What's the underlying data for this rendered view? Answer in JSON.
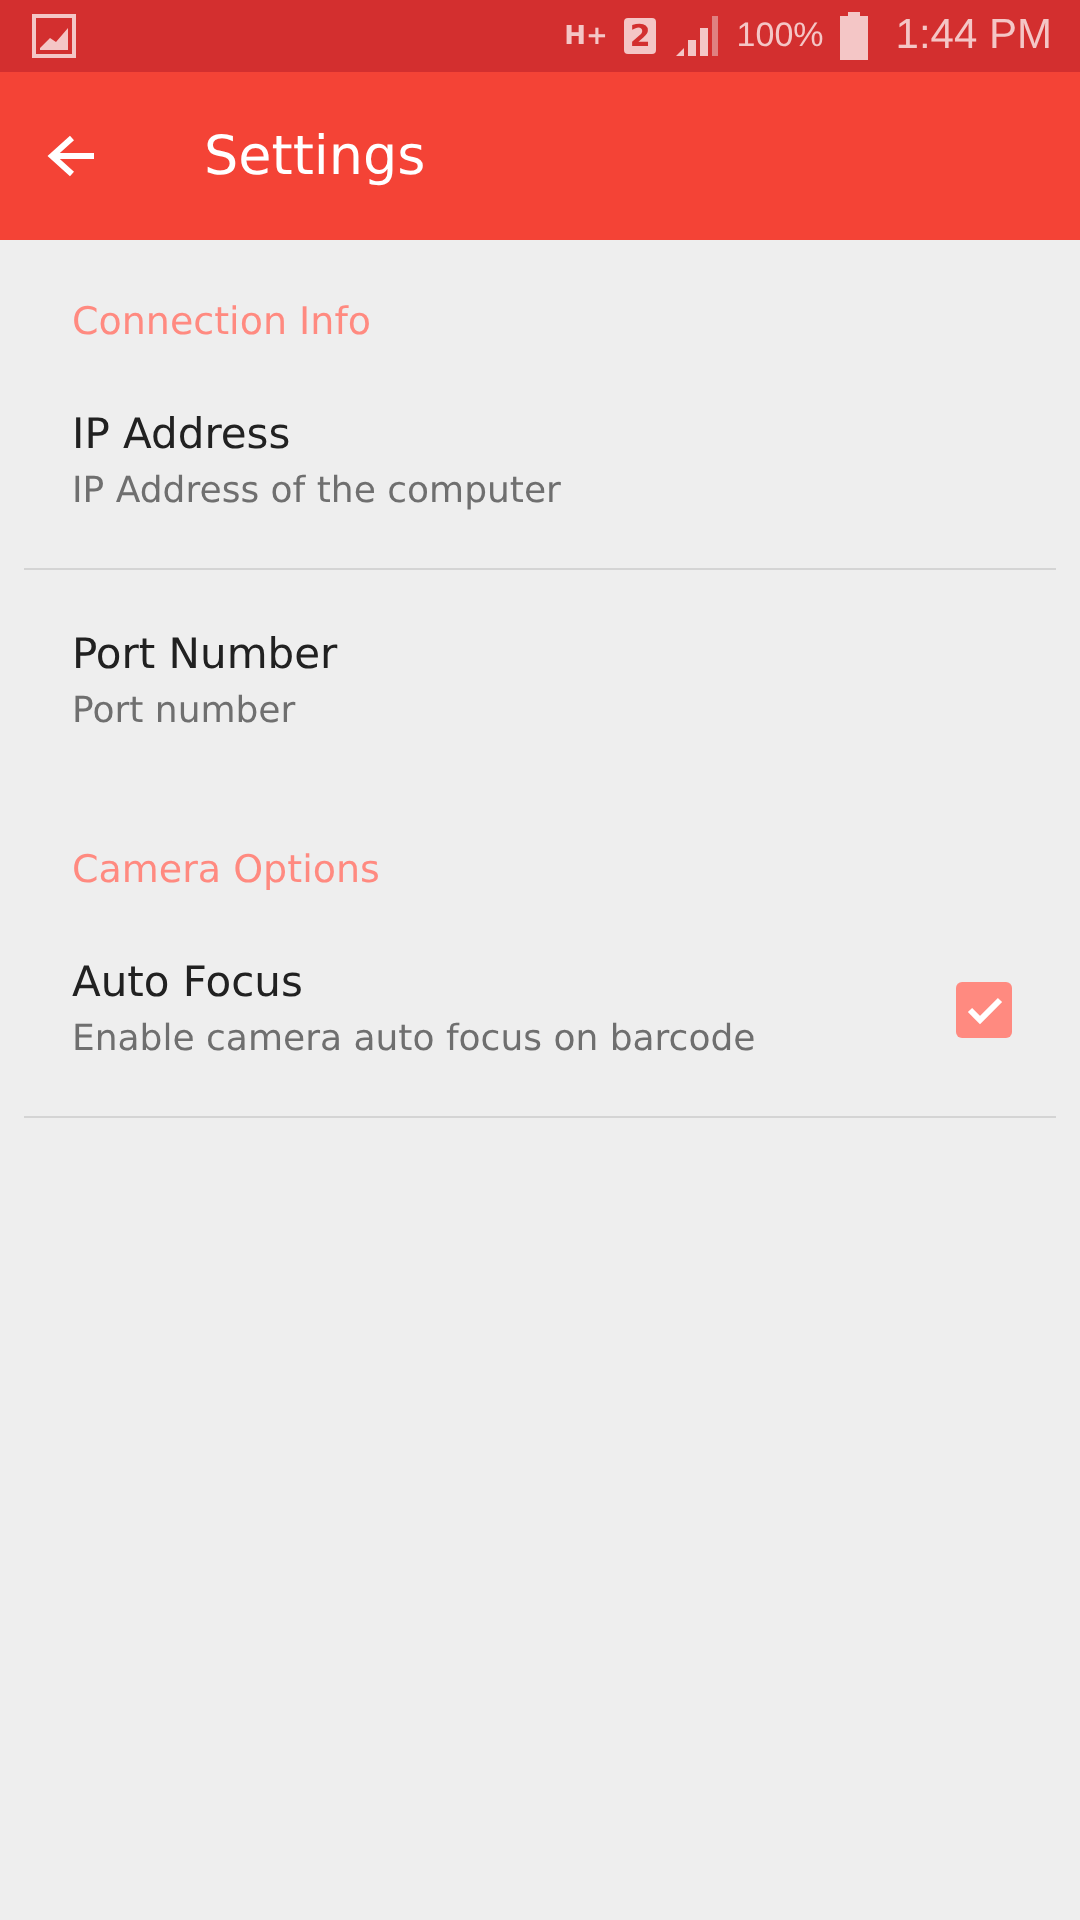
{
  "status_bar": {
    "network": "H+",
    "sim": "2",
    "battery": "100%",
    "time": "1:44 PM"
  },
  "toolbar": {
    "title": "Settings"
  },
  "sections": [
    {
      "header": "Connection Info",
      "items": [
        {
          "kind": "plain",
          "title": "IP Address",
          "summary": "IP Address of the computer"
        },
        {
          "kind": "plain",
          "title": "Port Number",
          "summary": "Port number"
        }
      ]
    },
    {
      "header": "Camera Options",
      "items": [
        {
          "kind": "checkbox",
          "title": "Auto Focus",
          "summary": "Enable camera auto focus on barcode",
          "checked": true
        }
      ]
    }
  ]
}
